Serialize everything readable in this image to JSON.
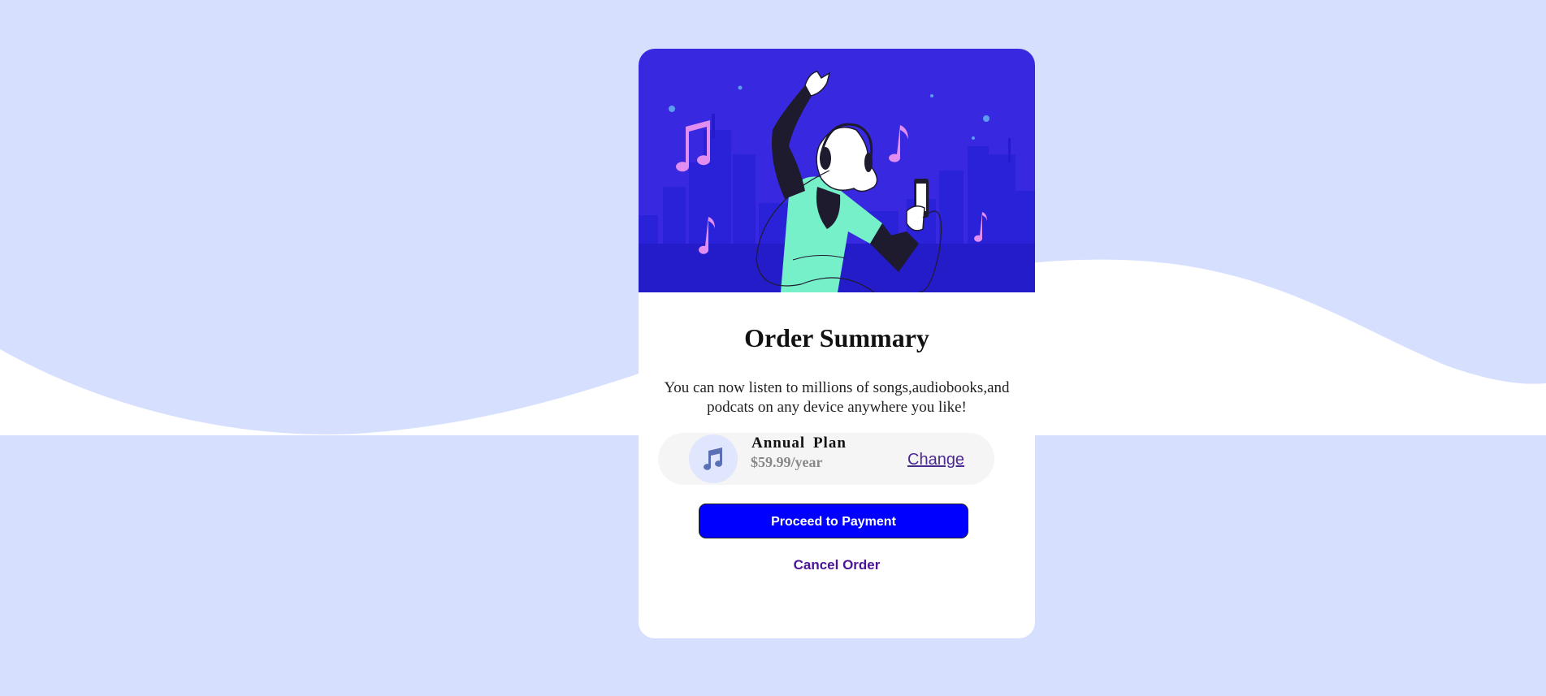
{
  "colors": {
    "page_background": "#d6e0fe",
    "card_background": "#ffffff",
    "hero_background": "#3829e0",
    "pay_button": "#0000ff",
    "cancel_text": "#4c1596",
    "change_link": "#4b2a90"
  },
  "hero": {
    "illustration": "person dancing with headphones and phone in city skyline with music notes"
  },
  "summary": {
    "title": "Order Summary",
    "description": "You can now listen to millions of songs,audiobooks,and podcats on any device anywhere you like!"
  },
  "plan": {
    "icon": "music-note-icon",
    "name": "Annual  Plan",
    "price": "$59.99/year",
    "change_label": "Change"
  },
  "actions": {
    "pay_label": "Proceed to Payment",
    "cancel_label": "Cancel Order"
  }
}
